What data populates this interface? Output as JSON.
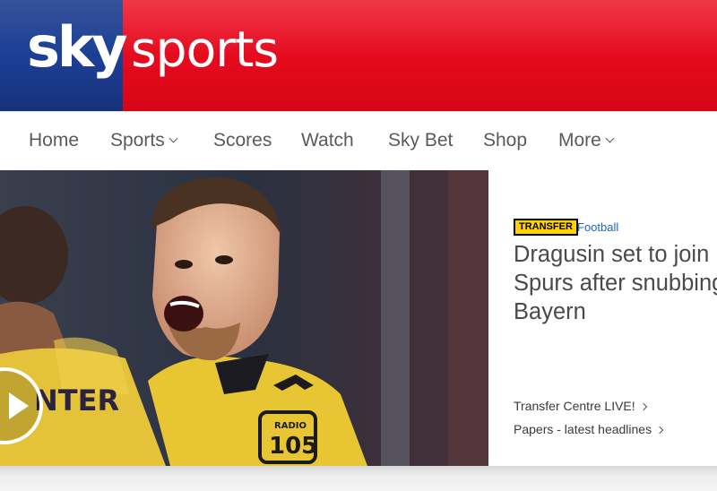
{
  "brand": {
    "logo_sky": "sky",
    "logo_sports": "sports",
    "colors": {
      "blue": "#1c3f96",
      "red": "#e30a1d"
    }
  },
  "nav": {
    "items": [
      {
        "label": "Home",
        "has_dropdown": false
      },
      {
        "label": "Sports",
        "has_dropdown": true
      },
      {
        "label": "Scores",
        "has_dropdown": false
      },
      {
        "label": "Watch",
        "has_dropdown": false
      },
      {
        "label": "Sky Bet",
        "has_dropdown": false
      },
      {
        "label": "Shop",
        "has_dropdown": false
      },
      {
        "label": "More",
        "has_dropdown": true
      }
    ]
  },
  "hero": {
    "image_icon": "football-player-photo",
    "play_icon": "play-icon",
    "shirt_text": "NTER",
    "shirt_badge_top": "RADIO",
    "shirt_badge_num": "105"
  },
  "story": {
    "badge": "TRANSFER",
    "category": "Football",
    "headline": "Dragusin set to join\nSpurs after snubbing\nBayern",
    "links": [
      {
        "label": "Transfer Centre LIVE!"
      },
      {
        "label": "Papers - latest headlines"
      }
    ]
  }
}
